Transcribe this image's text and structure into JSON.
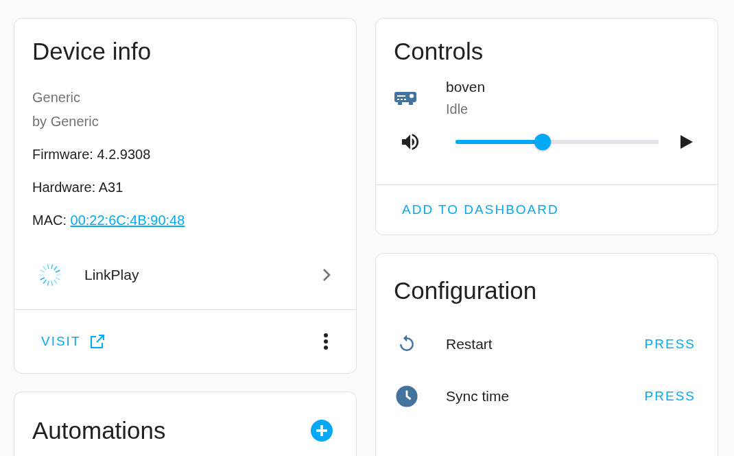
{
  "device_info": {
    "title": "Device info",
    "model": "Generic",
    "manufacturer": "by Generic",
    "details": [
      {
        "label": "Firmware:",
        "value": "4.2.9308",
        "kind": "text"
      },
      {
        "label": "Hardware:",
        "value": "A31",
        "kind": "text"
      },
      {
        "label": "MAC:",
        "value": "00:22:6C:4B:90:48",
        "kind": "link"
      }
    ],
    "integration": "LinkPlay",
    "visit_button": "VISIT"
  },
  "automations": {
    "title": "Automations"
  },
  "controls": {
    "title": "Controls",
    "entity": {
      "name": "boven",
      "state": "Idle"
    },
    "volume": {
      "level": 0.43
    },
    "add_button": "ADD TO DASHBOARD"
  },
  "configuration": {
    "title": "Configuration",
    "rows": [
      {
        "kind": "restart",
        "name": "Restart",
        "action": "PRESS"
      },
      {
        "kind": "clock",
        "name": "Sync time",
        "action": "PRESS"
      }
    ]
  }
}
